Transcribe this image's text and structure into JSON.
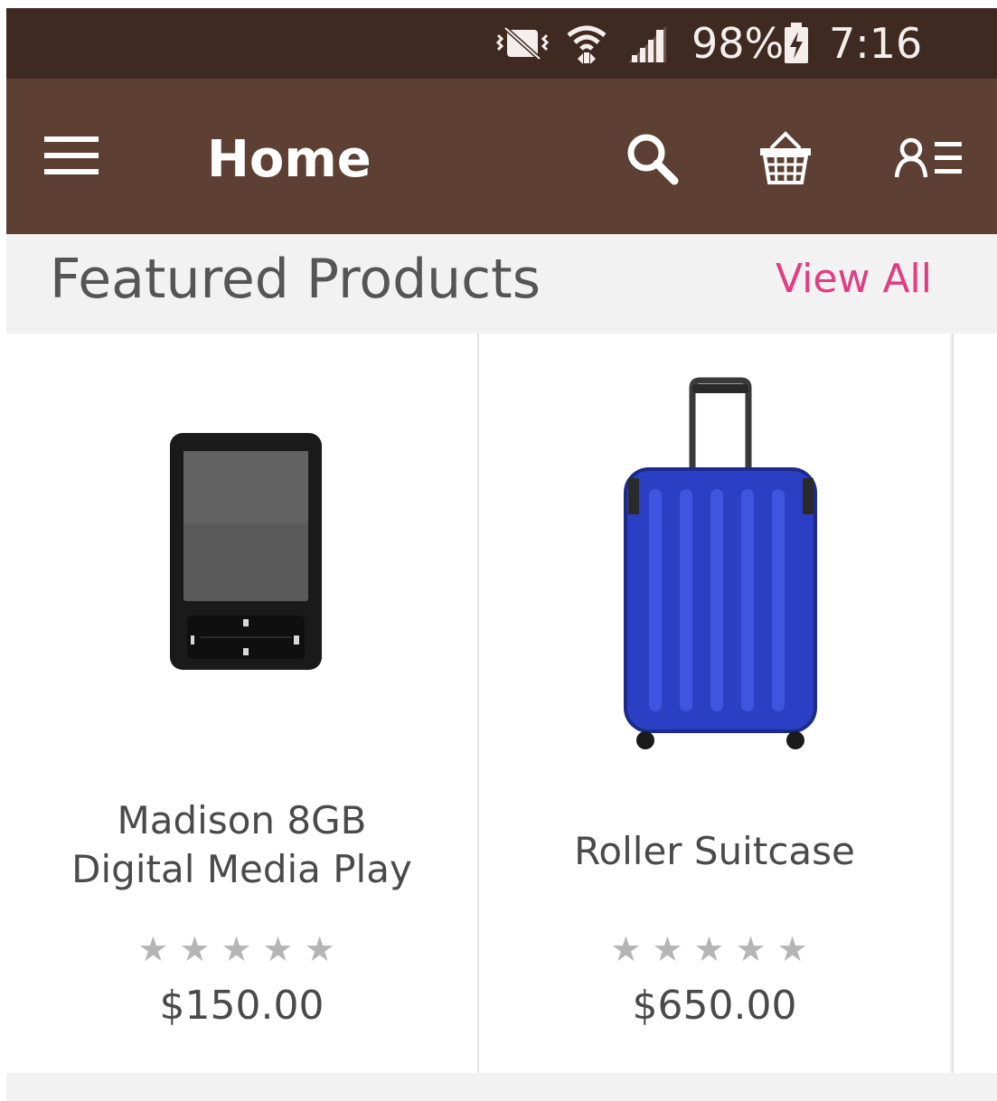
{
  "status_bar": {
    "battery": "98%",
    "time": "7:16 pm",
    "icons": [
      "vibrate-mute-icon",
      "wifi-icon",
      "signal-icon",
      "battery-charging-icon"
    ]
  },
  "app_bar": {
    "title": "Home",
    "icons": [
      "menu-icon",
      "search-icon",
      "basket-icon",
      "account-list-icon"
    ]
  },
  "featured": {
    "title": "Featured Products",
    "view_all": "View All"
  },
  "products": [
    {
      "name": "Madison 8GB Digital Media Play",
      "name_lines": [
        "Madison 8GB",
        "Digital Media Play"
      ],
      "rating": 0,
      "rating_max": 5,
      "stars": "★★★★★",
      "price": "$150.00",
      "image": "media-player-image"
    },
    {
      "name": "Roller Suitcase",
      "rating": 0,
      "rating_max": 5,
      "stars": "★★★★★",
      "price": "$650.00",
      "image": "suitcase-image"
    }
  ],
  "colors": {
    "status_bar": "#3f2a22",
    "app_bar": "#5d3f33",
    "accent": "#e23c82",
    "suitcase": "#2b3fc4"
  }
}
